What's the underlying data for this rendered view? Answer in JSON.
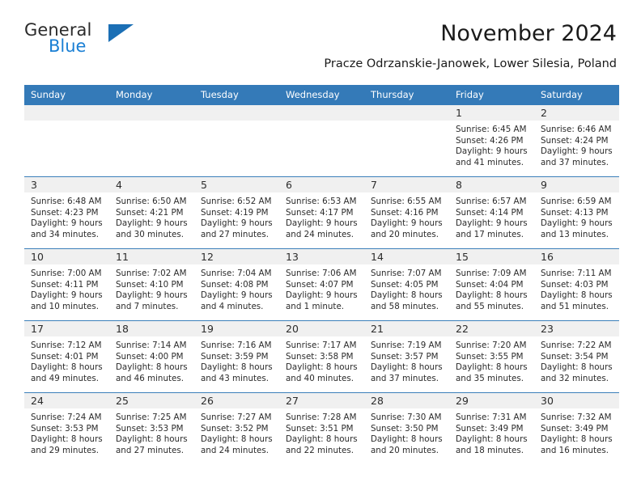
{
  "brand": {
    "line1": "General",
    "line2": "Blue",
    "triangle_color": "#1b6fb5",
    "blue_text_color": "#1a7fd4"
  },
  "header": {
    "title": "November 2024",
    "subtitle": "Pracze Odrzanskie-Janowek, Lower Silesia, Poland"
  },
  "calendar": {
    "header_bg": "#347ab8",
    "daynum_bg": "#f0f0f0",
    "weekday_headers": [
      "Sunday",
      "Monday",
      "Tuesday",
      "Wednesday",
      "Thursday",
      "Friday",
      "Saturday"
    ],
    "weeks": [
      [
        {
          "day": "",
          "lines": []
        },
        {
          "day": "",
          "lines": []
        },
        {
          "day": "",
          "lines": []
        },
        {
          "day": "",
          "lines": []
        },
        {
          "day": "",
          "lines": []
        },
        {
          "day": "1",
          "lines": [
            "Sunrise: 6:45 AM",
            "Sunset: 4:26 PM",
            "Daylight: 9 hours",
            "and 41 minutes."
          ]
        },
        {
          "day": "2",
          "lines": [
            "Sunrise: 6:46 AM",
            "Sunset: 4:24 PM",
            "Daylight: 9 hours",
            "and 37 minutes."
          ]
        }
      ],
      [
        {
          "day": "3",
          "lines": [
            "Sunrise: 6:48 AM",
            "Sunset: 4:23 PM",
            "Daylight: 9 hours",
            "and 34 minutes."
          ]
        },
        {
          "day": "4",
          "lines": [
            "Sunrise: 6:50 AM",
            "Sunset: 4:21 PM",
            "Daylight: 9 hours",
            "and 30 minutes."
          ]
        },
        {
          "day": "5",
          "lines": [
            "Sunrise: 6:52 AM",
            "Sunset: 4:19 PM",
            "Daylight: 9 hours",
            "and 27 minutes."
          ]
        },
        {
          "day": "6",
          "lines": [
            "Sunrise: 6:53 AM",
            "Sunset: 4:17 PM",
            "Daylight: 9 hours",
            "and 24 minutes."
          ]
        },
        {
          "day": "7",
          "lines": [
            "Sunrise: 6:55 AM",
            "Sunset: 4:16 PM",
            "Daylight: 9 hours",
            "and 20 minutes."
          ]
        },
        {
          "day": "8",
          "lines": [
            "Sunrise: 6:57 AM",
            "Sunset: 4:14 PM",
            "Daylight: 9 hours",
            "and 17 minutes."
          ]
        },
        {
          "day": "9",
          "lines": [
            "Sunrise: 6:59 AM",
            "Sunset: 4:13 PM",
            "Daylight: 9 hours",
            "and 13 minutes."
          ]
        }
      ],
      [
        {
          "day": "10",
          "lines": [
            "Sunrise: 7:00 AM",
            "Sunset: 4:11 PM",
            "Daylight: 9 hours",
            "and 10 minutes."
          ]
        },
        {
          "day": "11",
          "lines": [
            "Sunrise: 7:02 AM",
            "Sunset: 4:10 PM",
            "Daylight: 9 hours",
            "and 7 minutes."
          ]
        },
        {
          "day": "12",
          "lines": [
            "Sunrise: 7:04 AM",
            "Sunset: 4:08 PM",
            "Daylight: 9 hours",
            "and 4 minutes."
          ]
        },
        {
          "day": "13",
          "lines": [
            "Sunrise: 7:06 AM",
            "Sunset: 4:07 PM",
            "Daylight: 9 hours",
            "and 1 minute."
          ]
        },
        {
          "day": "14",
          "lines": [
            "Sunrise: 7:07 AM",
            "Sunset: 4:05 PM",
            "Daylight: 8 hours",
            "and 58 minutes."
          ]
        },
        {
          "day": "15",
          "lines": [
            "Sunrise: 7:09 AM",
            "Sunset: 4:04 PM",
            "Daylight: 8 hours",
            "and 55 minutes."
          ]
        },
        {
          "day": "16",
          "lines": [
            "Sunrise: 7:11 AM",
            "Sunset: 4:03 PM",
            "Daylight: 8 hours",
            "and 51 minutes."
          ]
        }
      ],
      [
        {
          "day": "17",
          "lines": [
            "Sunrise: 7:12 AM",
            "Sunset: 4:01 PM",
            "Daylight: 8 hours",
            "and 49 minutes."
          ]
        },
        {
          "day": "18",
          "lines": [
            "Sunrise: 7:14 AM",
            "Sunset: 4:00 PM",
            "Daylight: 8 hours",
            "and 46 minutes."
          ]
        },
        {
          "day": "19",
          "lines": [
            "Sunrise: 7:16 AM",
            "Sunset: 3:59 PM",
            "Daylight: 8 hours",
            "and 43 minutes."
          ]
        },
        {
          "day": "20",
          "lines": [
            "Sunrise: 7:17 AM",
            "Sunset: 3:58 PM",
            "Daylight: 8 hours",
            "and 40 minutes."
          ]
        },
        {
          "day": "21",
          "lines": [
            "Sunrise: 7:19 AM",
            "Sunset: 3:57 PM",
            "Daylight: 8 hours",
            "and 37 minutes."
          ]
        },
        {
          "day": "22",
          "lines": [
            "Sunrise: 7:20 AM",
            "Sunset: 3:55 PM",
            "Daylight: 8 hours",
            "and 35 minutes."
          ]
        },
        {
          "day": "23",
          "lines": [
            "Sunrise: 7:22 AM",
            "Sunset: 3:54 PM",
            "Daylight: 8 hours",
            "and 32 minutes."
          ]
        }
      ],
      [
        {
          "day": "24",
          "lines": [
            "Sunrise: 7:24 AM",
            "Sunset: 3:53 PM",
            "Daylight: 8 hours",
            "and 29 minutes."
          ]
        },
        {
          "day": "25",
          "lines": [
            "Sunrise: 7:25 AM",
            "Sunset: 3:53 PM",
            "Daylight: 8 hours",
            "and 27 minutes."
          ]
        },
        {
          "day": "26",
          "lines": [
            "Sunrise: 7:27 AM",
            "Sunset: 3:52 PM",
            "Daylight: 8 hours",
            "and 24 minutes."
          ]
        },
        {
          "day": "27",
          "lines": [
            "Sunrise: 7:28 AM",
            "Sunset: 3:51 PM",
            "Daylight: 8 hours",
            "and 22 minutes."
          ]
        },
        {
          "day": "28",
          "lines": [
            "Sunrise: 7:30 AM",
            "Sunset: 3:50 PM",
            "Daylight: 8 hours",
            "and 20 minutes."
          ]
        },
        {
          "day": "29",
          "lines": [
            "Sunrise: 7:31 AM",
            "Sunset: 3:49 PM",
            "Daylight: 8 hours",
            "and 18 minutes."
          ]
        },
        {
          "day": "30",
          "lines": [
            "Sunrise: 7:32 AM",
            "Sunset: 3:49 PM",
            "Daylight: 8 hours",
            "and 16 minutes."
          ]
        }
      ]
    ]
  }
}
